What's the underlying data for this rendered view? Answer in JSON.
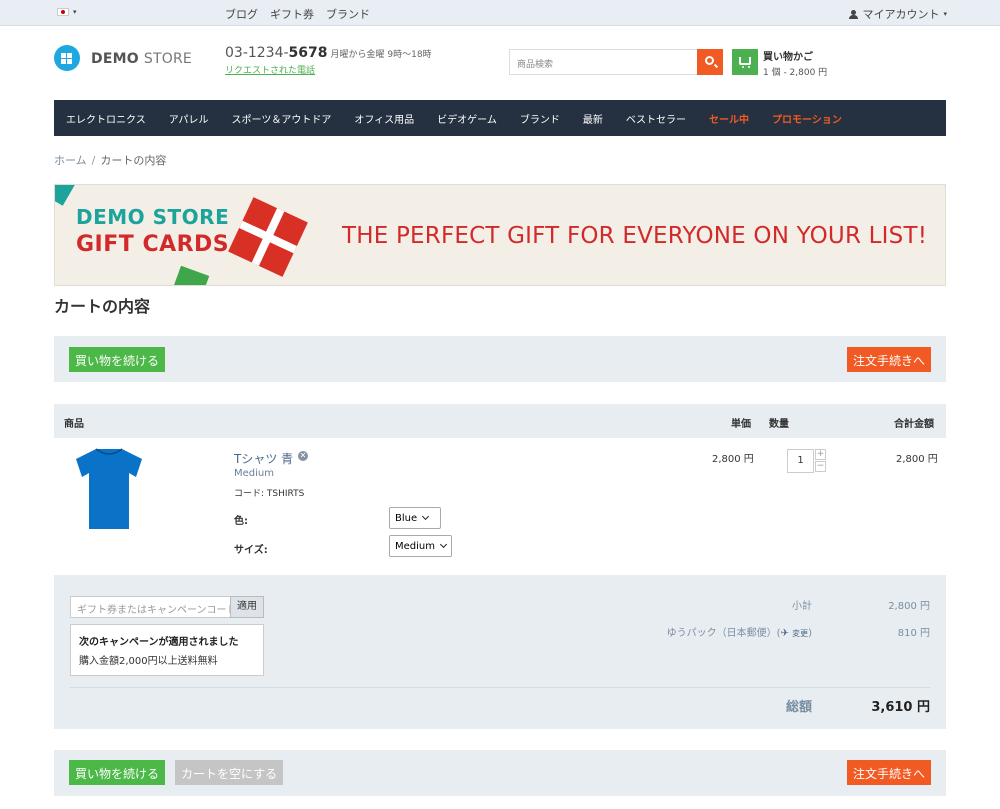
{
  "topbar": {
    "links": [
      "ブログ",
      "ギフト券",
      "ブランド"
    ],
    "account_label": "マイアカウント",
    "account_caret": "▾",
    "flag_caret": "▾"
  },
  "header": {
    "logo_bold": "DEMO",
    "logo_light": "STORE",
    "phone_prefix": "03-1234-",
    "phone_bold": "5678",
    "hours": "月曜から金曜 9時～18時",
    "callback": "リクエストされた電話",
    "search_placeholder": "商品検索",
    "cart_title": "買い物かご",
    "cart_summary": "1 個 - 2,800 円"
  },
  "nav": {
    "items": [
      "エレクトロニクス",
      "アパレル",
      "スポーツ＆アウトドア",
      "オフィス用品",
      "ビデオゲーム",
      "ブランド",
      "最新",
      "ベストセラー"
    ],
    "hot_items": [
      "セール中",
      "プロモーション"
    ]
  },
  "breadcrumb": {
    "home": "ホーム",
    "sep": "/",
    "current": "カートの内容"
  },
  "banner": {
    "line1": "DEMO STORE",
    "line2": "GIFT CARDS",
    "tagline": "THE PERFECT GIFT FOR EVERYONE ON YOUR LIST!"
  },
  "page_title": "カートの内容",
  "buttons": {
    "continue": "買い物を続ける",
    "checkout": "注文手続きへ",
    "clear": "カートを空にする"
  },
  "table": {
    "headers": {
      "product": "商品",
      "unit_price": "単価",
      "qty": "数量",
      "total": "合計金額"
    }
  },
  "item": {
    "name": "Tシャツ 青",
    "remove_glyph": "✕",
    "variant": "Medium",
    "code": "コード: TSHIRTS",
    "color_label": "色:",
    "color_value": "Blue",
    "size_label": "サイズ:",
    "size_value": "Medium",
    "unit_price": "2,800 円",
    "qty": "1",
    "plus": "+",
    "minus": "−",
    "total": "2,800 円",
    "color": "#0a73c8"
  },
  "summary": {
    "coupon_placeholder": "ギフト券またはキャンペーンコード",
    "apply": "適用",
    "promo_title": "次のキャンペーンが適用されました",
    "promo_desc": "購入金額2,000円以上送料無料",
    "subtotal_label": "小計",
    "subtotal_value": "2,800 円",
    "shipping_label": "ゆうパック（日本郵便）",
    "shipping_paren_open": "(",
    "plane_glyph": "✈",
    "change_link": "変更",
    "shipping_paren_close": ")",
    "shipping_value": "810 円",
    "total_label": "総額",
    "total_value": "3,610 円"
  },
  "colors": {
    "accent_orange": "#f15a22",
    "accent_green": "#4cb848",
    "nav_bg": "#253140",
    "panel_bg": "#e8edf1"
  }
}
